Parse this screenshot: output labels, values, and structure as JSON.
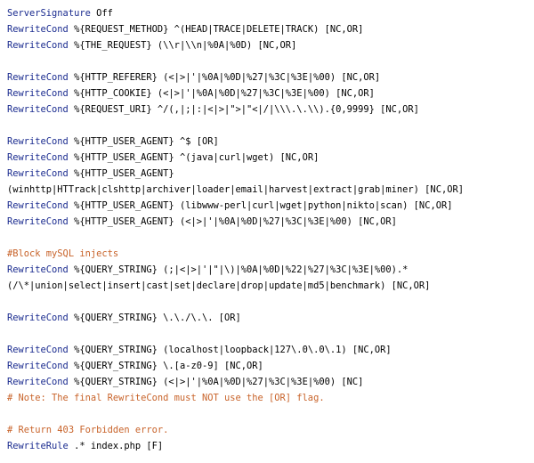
{
  "code": {
    "lines": [
      {
        "kind": "code",
        "keyword": "ServerSignature",
        "rest": " Off"
      },
      {
        "kind": "code",
        "keyword": "RewriteCond",
        "rest": " %{REQUEST_METHOD} ^(HEAD|TRACE|DELETE|TRACK) [NC,OR]"
      },
      {
        "kind": "code",
        "keyword": "RewriteCond",
        "rest": " %{THE_REQUEST} (\\\\r|\\\\n|%0A|%0D) [NC,OR]"
      },
      {
        "kind": "blank"
      },
      {
        "kind": "code",
        "keyword": "RewriteCond",
        "rest": " %{HTTP_REFERER} (<|>|'|%0A|%0D|%27|%3C|%3E|%00) [NC,OR]"
      },
      {
        "kind": "code",
        "keyword": "RewriteCond",
        "rest": " %{HTTP_COOKIE} (<|>|'|%0A|%0D|%27|%3C|%3E|%00) [NC,OR]"
      },
      {
        "kind": "code",
        "keyword": "RewriteCond",
        "rest": " %{REQUEST_URI} ^/(,|;|:|<|>|\">|\"<|/|\\\\\\.\\.\\\\).{0,9999} [NC,OR]"
      },
      {
        "kind": "blank"
      },
      {
        "kind": "code",
        "keyword": "RewriteCond",
        "rest": " %{HTTP_USER_AGENT} ^$ [OR]"
      },
      {
        "kind": "code",
        "keyword": "RewriteCond",
        "rest": " %{HTTP_USER_AGENT} ^(java|curl|wget) [NC,OR]"
      },
      {
        "kind": "code",
        "keyword": "RewriteCond",
        "rest": " %{HTTP_USER_AGENT}"
      },
      {
        "kind": "plain",
        "text": "(winhttp|HTTrack|clshttp|archiver|loader|email|harvest|extract|grab|miner) [NC,OR]"
      },
      {
        "kind": "code",
        "keyword": "RewriteCond",
        "rest": " %{HTTP_USER_AGENT} (libwww-perl|curl|wget|python|nikto|scan) [NC,OR]"
      },
      {
        "kind": "code",
        "keyword": "RewriteCond",
        "rest": " %{HTTP_USER_AGENT} (<|>|'|%0A|%0D|%27|%3C|%3E|%00) [NC,OR]"
      },
      {
        "kind": "blank"
      },
      {
        "kind": "comment",
        "text": "#Block mySQL injects"
      },
      {
        "kind": "code",
        "keyword": "RewriteCond",
        "rest": " %{QUERY_STRING} (;|<|>|'|\"|\\)|%0A|%0D|%22|%27|%3C|%3E|%00).*"
      },
      {
        "kind": "plain",
        "text": "(/\\*|union|select|insert|cast|set|declare|drop|update|md5|benchmark) [NC,OR]"
      },
      {
        "kind": "blank"
      },
      {
        "kind": "code",
        "keyword": "RewriteCond",
        "rest": " %{QUERY_STRING} \\.\\./\\.\\. [OR]"
      },
      {
        "kind": "blank"
      },
      {
        "kind": "code",
        "keyword": "RewriteCond",
        "rest": " %{QUERY_STRING} (localhost|loopback|127\\.0\\.0\\.1) [NC,OR]"
      },
      {
        "kind": "code",
        "keyword": "RewriteCond",
        "rest": " %{QUERY_STRING} \\.[a-z0-9] [NC,OR]"
      },
      {
        "kind": "code",
        "keyword": "RewriteCond",
        "rest": " %{QUERY_STRING} (<|>|'|%0A|%0D|%27|%3C|%3E|%00) [NC]"
      },
      {
        "kind": "comment",
        "text": "# Note: The final RewriteCond must NOT use the [OR] flag."
      },
      {
        "kind": "blank"
      },
      {
        "kind": "comment",
        "text": "# Return 403 Forbidden error."
      },
      {
        "kind": "code",
        "keyword": "RewriteRule",
        "rest": " .* index.php [F]"
      }
    ]
  },
  "colors": {
    "keyword": "#1a2b8f",
    "comment": "#c8632a",
    "text": "#000000",
    "background": "#ffffff"
  }
}
